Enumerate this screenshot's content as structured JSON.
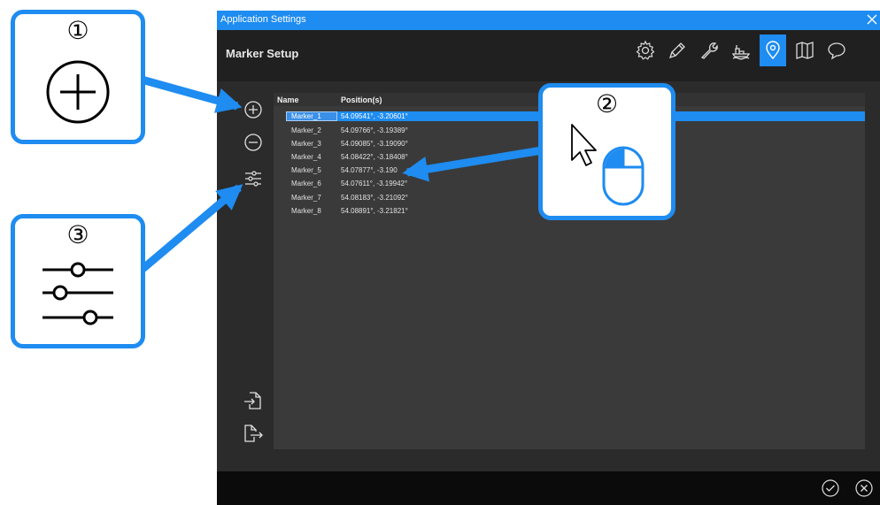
{
  "window": {
    "title": "Application Settings",
    "page_title": "Marker Setup",
    "accent": "#1e8cf0"
  },
  "toolbar": {
    "icons": [
      "gear-icon",
      "pen-icon",
      "wrench-icon",
      "vessel-icon",
      "location-pin-icon",
      "map-icon",
      "speech-bubble-icon"
    ],
    "active": "location-pin-icon"
  },
  "sidebar": {
    "icons": [
      "add-icon",
      "remove-icon",
      "sliders-icon",
      "import-icon",
      "export-icon"
    ]
  },
  "table": {
    "columns": [
      "Name",
      "Position(s)"
    ],
    "rows": [
      {
        "name": "Marker_1",
        "position": "54.09541°, -3.20601°"
      },
      {
        "name": "Marker_2",
        "position": "54.09766°, -3.19389°"
      },
      {
        "name": "Marker_3",
        "position": "54.09085°, -3.19090°"
      },
      {
        "name": "Marker_4",
        "position": "54.08422°, -3.18408°"
      },
      {
        "name": "Marker_5",
        "position": "54.07877°, -3.190"
      },
      {
        "name": "Marker_6",
        "position": "54.07611°, -3.19942°"
      },
      {
        "name": "Marker_7",
        "position": "54.08183°, -3.21092°"
      },
      {
        "name": "Marker_8",
        "position": "54.08891°, -3.21821°"
      }
    ],
    "selected_index": 0
  },
  "footer": {
    "icons": [
      "confirm-icon",
      "cancel-icon"
    ]
  },
  "callouts": [
    {
      "number": "①",
      "icon": "add-icon"
    },
    {
      "number": "②",
      "icon": "mouse-click-icon"
    },
    {
      "number": "③",
      "icon": "sliders-icon"
    }
  ]
}
